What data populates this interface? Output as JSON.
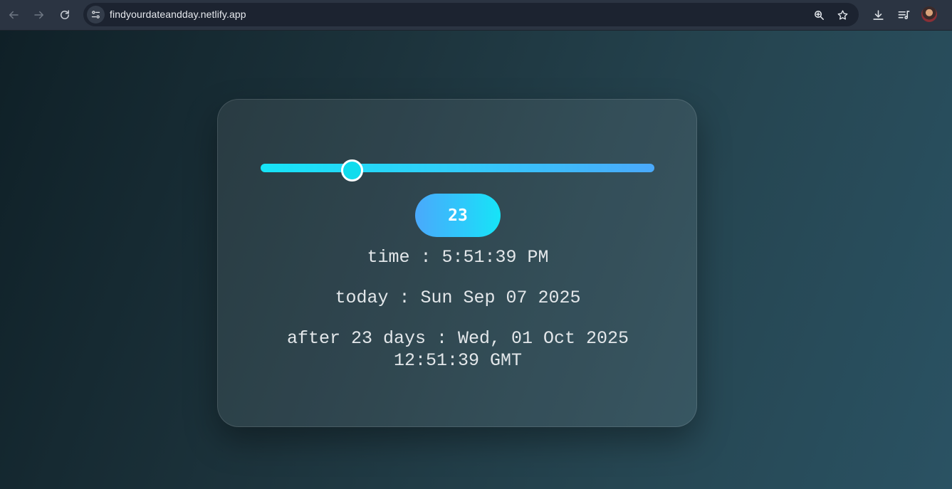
{
  "browser": {
    "url": "findyourdateandday.netlify.app",
    "icons": {
      "back": "back-arrow-icon",
      "forward": "forward-arrow-icon",
      "reload": "reload-icon",
      "site_info": "site-info-icon",
      "zoom": "zoom-icon",
      "bookmark": "bookmark-star-icon",
      "download": "download-icon",
      "media": "media-controls-icon",
      "profile": "profile-avatar"
    }
  },
  "app": {
    "slider": {
      "value": 23,
      "min": 0,
      "max": 100
    },
    "value_display": "23",
    "time_line": "time : 5:51:39 PM",
    "today_line": "today : Sun Sep 07 2025",
    "after_line_1": "after 23 days : Wed, 01 Oct 2025",
    "after_line_2": "12:51:39 GMT"
  },
  "colors": {
    "accent_cyan": "#16e4f7",
    "accent_blue": "#4aa9fb",
    "text_light": "#e3e7ea"
  }
}
